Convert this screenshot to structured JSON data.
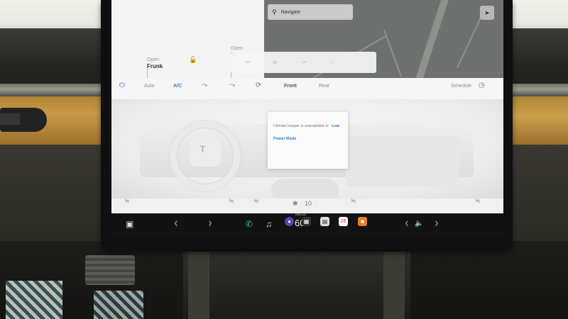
{
  "vehicle": {
    "frunk": {
      "status": "Open",
      "label": "Frunk"
    },
    "trunk": {
      "status": "Open",
      "label": "Tr"
    }
  },
  "navigation": {
    "placeholder": "Navigate"
  },
  "climate": {
    "power_icon": "power-icon",
    "auto": "Auto",
    "ac": "A/C",
    "front": "Front",
    "rear": "Rear",
    "schedule": "Schedule",
    "fan_speed": "10"
  },
  "tooltip": {
    "text": "Climate keeper is unavailable in",
    "highlight": "Low Power Mode"
  },
  "dock": {
    "speed_label": "Manual",
    "speed_value": "60",
    "calendar_day": "26"
  },
  "colors": {
    "accent": "#2f7de0",
    "dock_bg": "#121212",
    "screen_bg": "#f0f0f0"
  }
}
